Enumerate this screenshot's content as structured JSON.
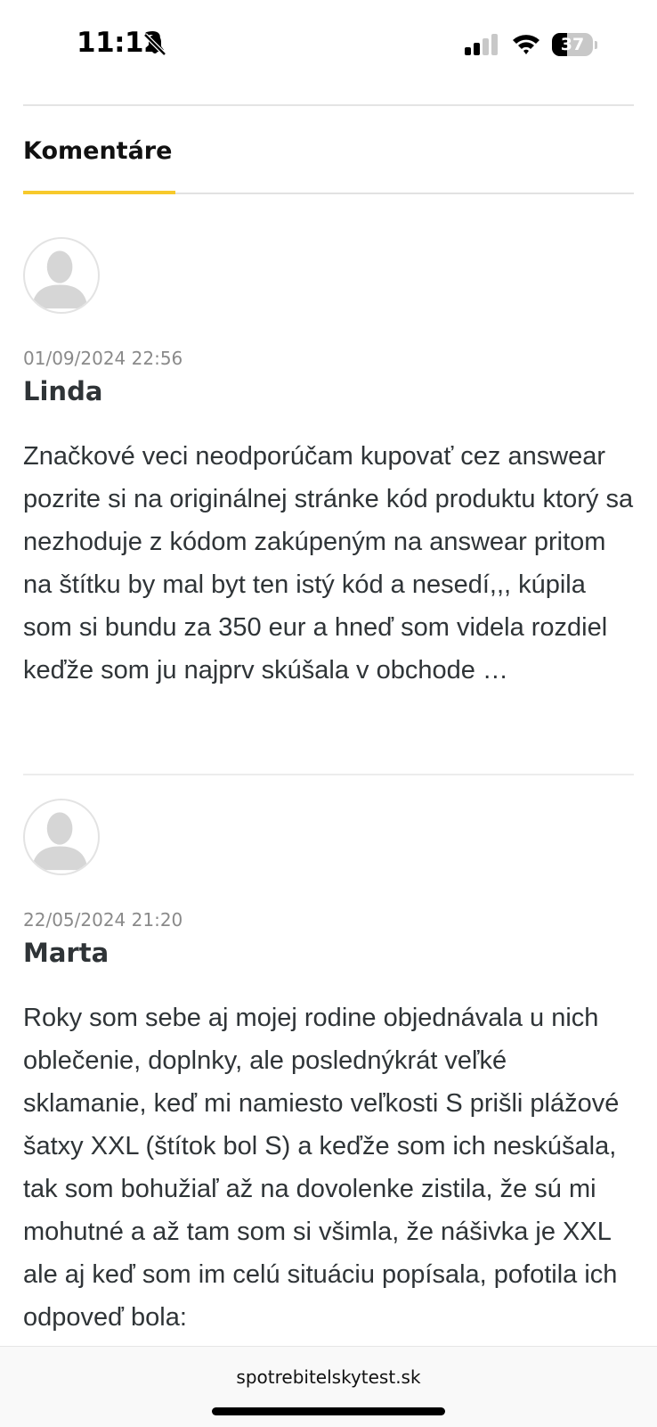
{
  "status_bar": {
    "time": "11:12",
    "battery_level": "37",
    "battery_fraction": 0.37,
    "icons": [
      "bell-slash-icon",
      "cellular-signal-icon",
      "wifi-icon",
      "battery-icon"
    ]
  },
  "section": {
    "title": "Komentáre",
    "accent_color": "#f7c92b"
  },
  "comments": [
    {
      "date": "01/09/2024 22:56",
      "author": "Linda",
      "text": "Značkové veci neodporúčam kupovať cez answear pozrite si na originálnej stránke kód produktu ktorý sa nezhoduje z kódom zakúpeným na answear pritom na štítku by mal byt ten istý kód a nesedí,,, kúpila som si bundu za 350 eur a hneď som videla rozdiel keďže som ju najprv skúšala v obchode …",
      "avatar_icon": "user-silhouette-icon"
    },
    {
      "date": "22/05/2024 21:20",
      "author": "Marta",
      "text": "Roky som sebe aj mojej rodine objednávala u nich oblečenie, doplnky, ale poslednýkrát veľké sklamanie, keď mi namiesto veľkosti S prišli plážové šatxy XXL (štítok bol S) a keďže som ich neskúšala, tak som bohužiaľ až na dovolenke zistila, že sú mi mohutné a až tam som si všimla, že nášivka je XXL ale aj keď som im celú situáciu popísala, pofotila ich odpoveď bola:",
      "avatar_icon": "user-silhouette-icon"
    }
  ],
  "browser": {
    "url": "spotrebitelskytest.sk"
  }
}
